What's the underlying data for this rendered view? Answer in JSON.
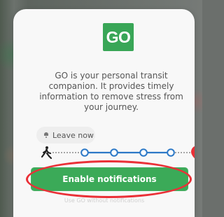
{
  "onboarding_modal": {
    "logo_text": "GO",
    "description": "GO is your personal transit companion. It provides timely information to remove stress from your journey.",
    "leave_label": "Leave now",
    "primary_button": "Enable notifications",
    "secondary_link": "Use GO without notifications"
  },
  "colors": {
    "brand_green": "#39a657",
    "button_green": "#3baa58",
    "route_blue": "#2d79c7",
    "destination_red": "#ea3037"
  },
  "icons": {
    "leave": "bell-icon",
    "walk": "walking-person-icon",
    "destination": "map-pin-icon"
  }
}
